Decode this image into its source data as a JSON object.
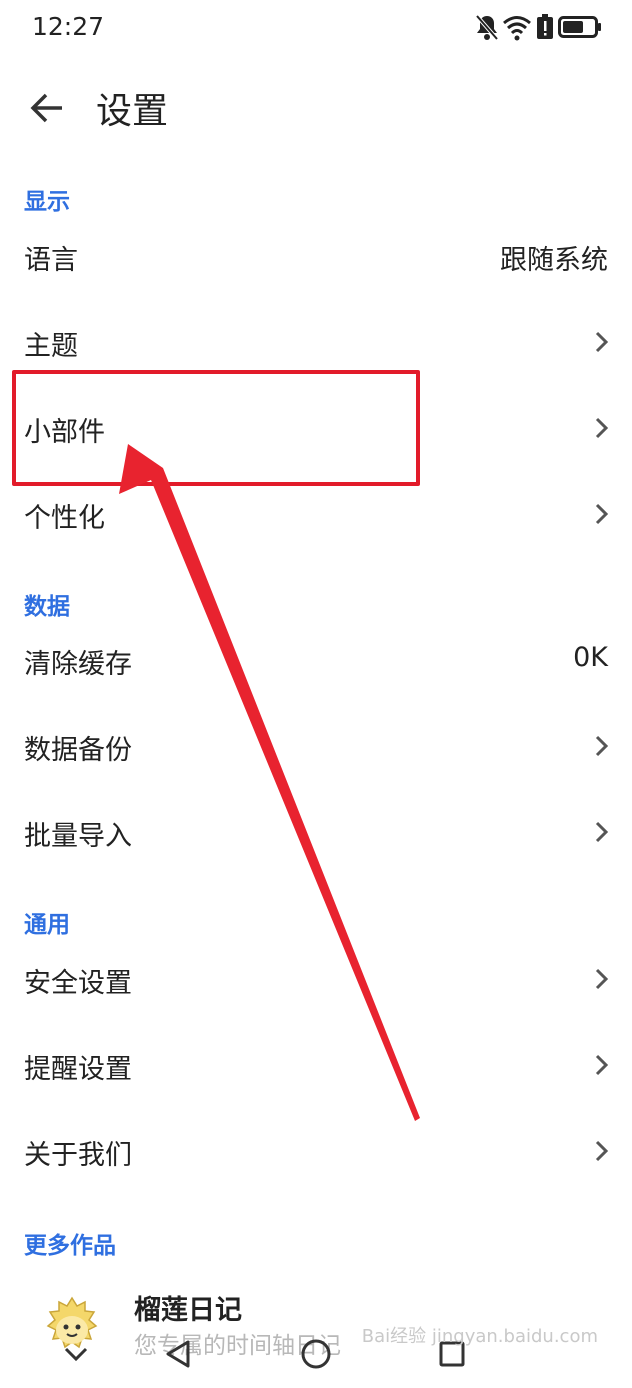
{
  "status_bar": {
    "time": "12:27",
    "icons": [
      "bell-off-icon",
      "wifi-icon",
      "battery-alert-icon",
      "battery-icon"
    ]
  },
  "app_bar": {
    "back_icon": "arrow-left-icon",
    "title": "设置"
  },
  "sections": {
    "display": {
      "header": "显示",
      "items": [
        {
          "label": "语言",
          "value": "跟随系统"
        },
        {
          "label": "主题"
        },
        {
          "label": "小部件"
        },
        {
          "label": "个性化"
        }
      ]
    },
    "data": {
      "header": "数据",
      "items": [
        {
          "label": "清除缓存",
          "value": "0K"
        },
        {
          "label": "数据备份"
        },
        {
          "label": "批量导入"
        }
      ]
    },
    "general": {
      "header": "通用",
      "items": [
        {
          "label": "安全设置"
        },
        {
          "label": "提醒设置"
        },
        {
          "label": "关于我们"
        }
      ]
    },
    "more": {
      "header": "更多作品",
      "app_name": "榴莲日记",
      "app_desc": "您专属的时间轴日记"
    }
  },
  "nav_bar": {
    "icons": [
      "chevron-down-icon",
      "back-triangle-icon",
      "home-circle-icon",
      "recents-square-icon"
    ]
  },
  "watermark": "Bai经验 jingyan.baidu.com",
  "colors": {
    "accent": "#2f6fe0",
    "annotation": "#e21b2a",
    "text": "#222222"
  }
}
